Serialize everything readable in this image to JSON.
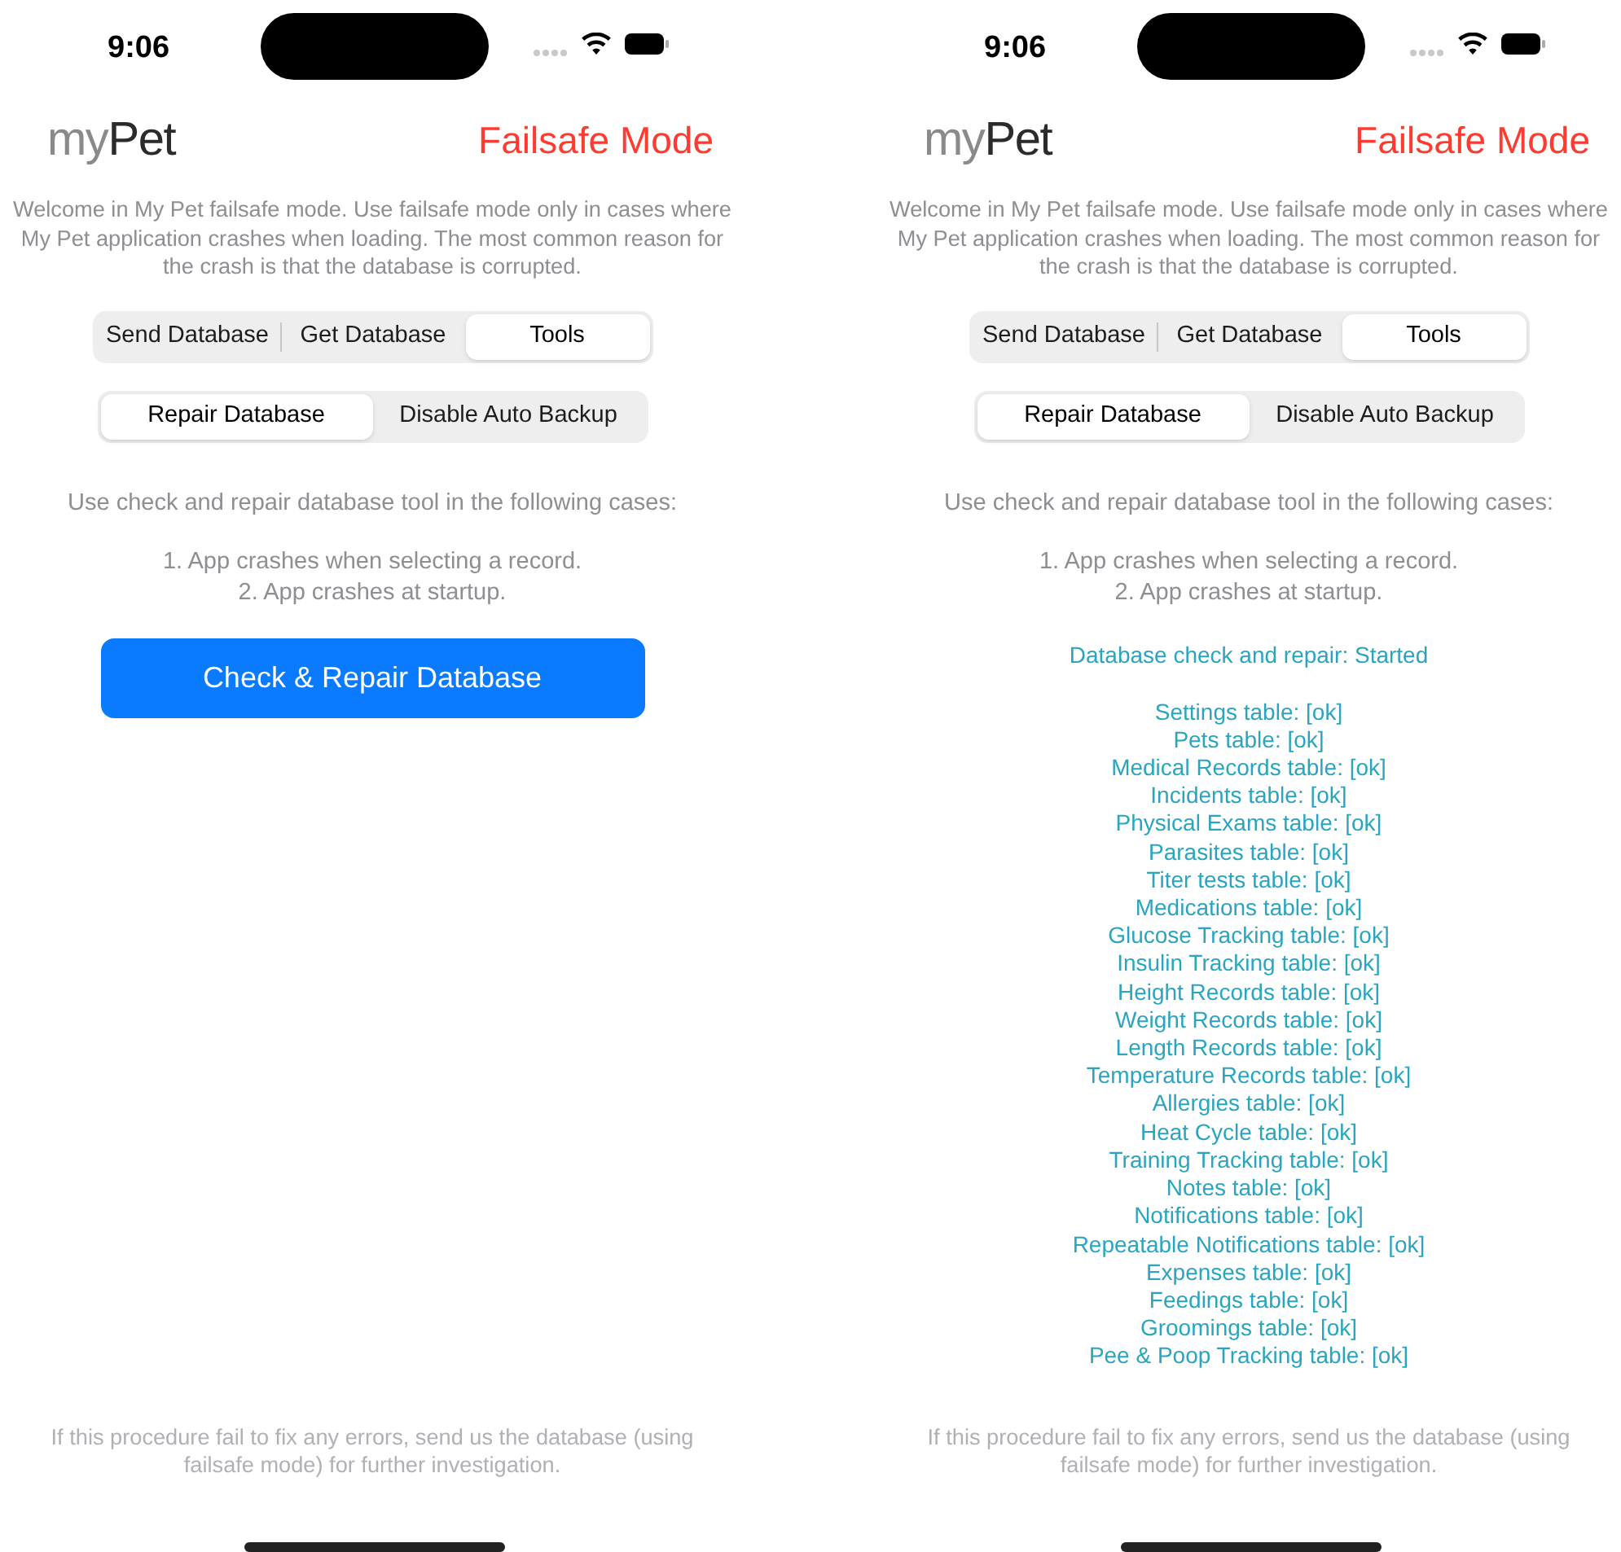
{
  "screens": [
    {
      "status_bar": {
        "time": "9:06"
      },
      "logo": {
        "prefix": "my",
        "name": "Pet"
      },
      "title": "Failsafe Mode",
      "intro": "Welcome in My Pet failsafe mode. Use failsafe mode only in cases where My Pet application crashes when loading. The most common reason for the crash is that the database is corrupted.",
      "main_tabs": [
        {
          "label": "Send Database",
          "selected": false
        },
        {
          "label": "Get Database",
          "selected": false
        },
        {
          "label": "Tools",
          "selected": true
        }
      ],
      "sub_tabs": [
        {
          "label": "Repair Database",
          "selected": true
        },
        {
          "label": "Disable Auto Backup",
          "selected": false
        }
      ],
      "instructions": "Use check and repair database tool in the following cases:",
      "cases": [
        "1. App crashes when selecting a record.",
        "2. App crashes at startup."
      ],
      "action_button": {
        "label": "Check & Repair Database"
      },
      "footer": "If this procedure fail to fix any errors, send us the database (using failsafe mode) for further investigation."
    },
    {
      "status_bar": {
        "time": "9:06"
      },
      "logo": {
        "prefix": "my",
        "name": "Pet"
      },
      "title": "Failsafe Mode",
      "intro": "Welcome in My Pet failsafe mode. Use failsafe mode only in cases where My Pet application crashes when loading. The most common reason for the crash is that the database is corrupted.",
      "main_tabs": [
        {
          "label": "Send Database",
          "selected": false
        },
        {
          "label": "Get Database",
          "selected": false
        },
        {
          "label": "Tools",
          "selected": true
        }
      ],
      "sub_tabs": [
        {
          "label": "Repair Database",
          "selected": true
        },
        {
          "label": "Disable Auto Backup",
          "selected": false
        }
      ],
      "instructions": "Use check and repair database tool in the following cases:",
      "cases": [
        "1. App crashes when selecting a record.",
        "2. App crashes at startup."
      ],
      "log": {
        "header": "Database check and repair: Started",
        "entries": [
          "Settings table: [ok]",
          "Pets table: [ok]",
          "Medical Records table: [ok]",
          "Incidents table: [ok]",
          "Physical Exams table: [ok]",
          "Parasites table: [ok]",
          "Titer tests table: [ok]",
          "Medications table: [ok]",
          "Glucose Tracking table: [ok]",
          "Insulin Tracking table: [ok]",
          "Height Records table: [ok]",
          "Weight Records table: [ok]",
          "Length Records table: [ok]",
          "Temperature Records table: [ok]",
          "Allergies table: [ok]",
          "Heat Cycle table: [ok]",
          "Training Tracking table: [ok]",
          "Notes table: [ok]",
          "Notifications table: [ok]",
          "Repeatable Notifications table: [ok]",
          "Expenses table: [ok]",
          "Feedings table: [ok]",
          "Groomings table: [ok]",
          "Pee & Poop Tracking table: [ok]"
        ]
      },
      "footer": "If this procedure fail to fix any errors, send us the database (using failsafe mode) for further investigation."
    }
  ]
}
